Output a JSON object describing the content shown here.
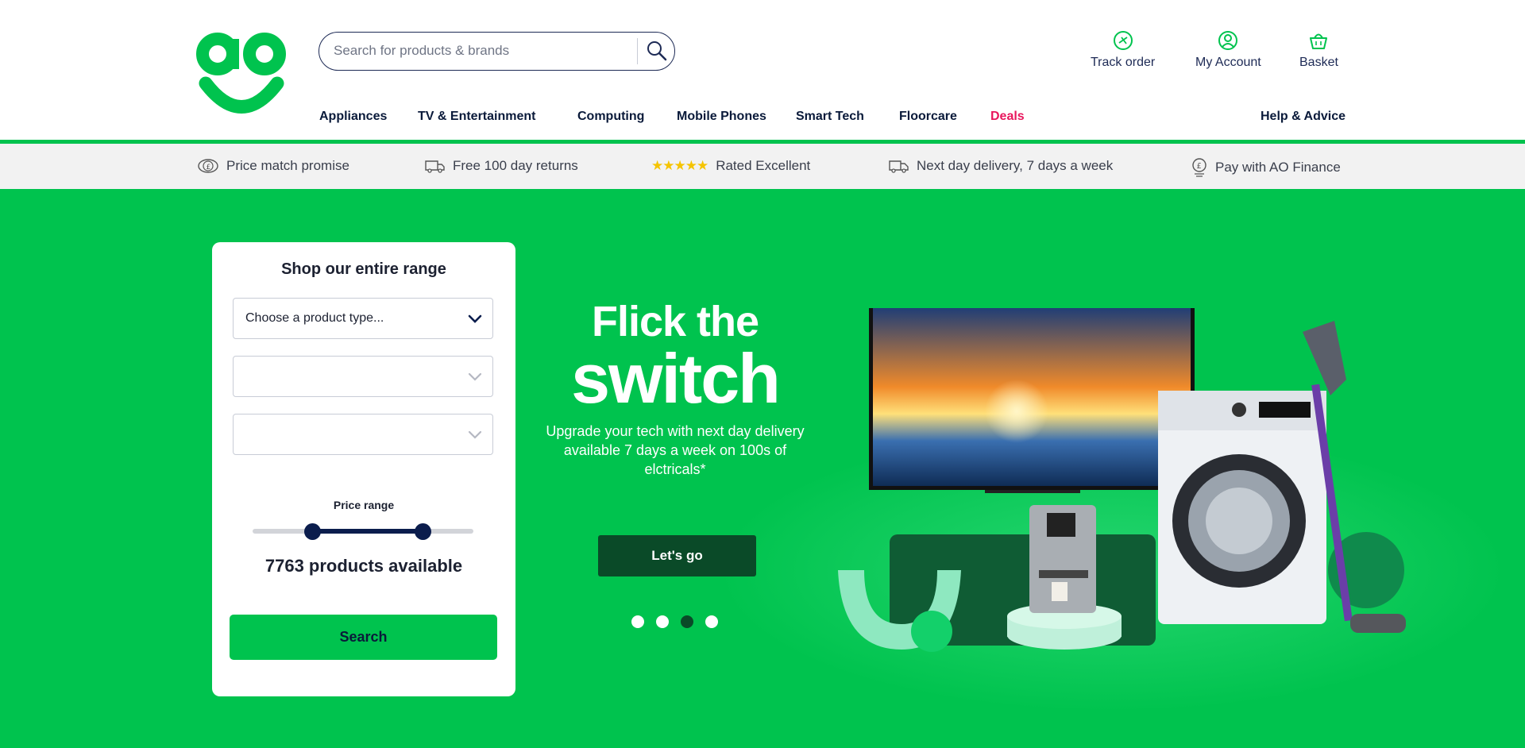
{
  "header": {
    "search": {
      "placeholder": "Search for products & brands"
    },
    "utility": {
      "track_order": "Track order",
      "my_account": "My Account",
      "basket": "Basket"
    },
    "nav": {
      "appliances": "Appliances",
      "tv": "TV & Entertainment",
      "computing": "Computing",
      "mobile": "Mobile Phones",
      "smart_tech": "Smart Tech",
      "floorcare": "Floorcare",
      "deals": "Deals",
      "help": "Help & Advice"
    }
  },
  "usps": {
    "price_match": "Price match promise",
    "returns": "Free 100 day returns",
    "stars": "★★★★★",
    "rated": "Rated Excellent",
    "delivery": "Next day delivery, 7 days a week",
    "finance": "Pay with AO Finance"
  },
  "shop_card": {
    "title": "Shop our entire range",
    "product_type": "Choose a product type...",
    "price_label": "Price range",
    "price_range": {
      "min_fraction": 0.27,
      "max_fraction": 0.77
    },
    "count_text": "7763 products available",
    "search_label": "Search"
  },
  "hero": {
    "headline_1": "Flick the",
    "headline_2": "switch",
    "subtext": "Upgrade your tech  with next day delivery available 7 days a week on 100s of elctricals*",
    "cta": "Let's go",
    "active_slide": 3,
    "slide_count": 4
  },
  "colors": {
    "brand_green": "#00c34e",
    "navy": "#0b1d4d",
    "deals_pink": "#e8175d",
    "cta_dark_green": "#0a4a28"
  }
}
